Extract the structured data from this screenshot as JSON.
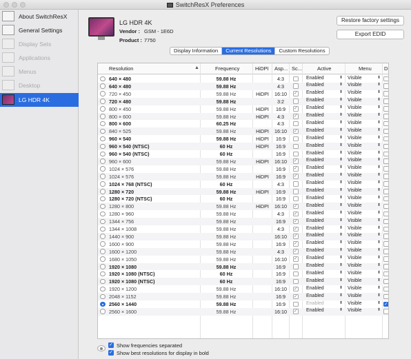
{
  "window": {
    "title": "SwitchResX Preferences"
  },
  "sidebar": {
    "items": [
      {
        "label": "About SwitchResX",
        "icon": "display-icon",
        "state": "normal"
      },
      {
        "label": "General Settings",
        "icon": "switch-icon",
        "state": "normal"
      },
      {
        "label": "Display Sets",
        "icon": "display-sets-icon",
        "state": "disabled"
      },
      {
        "label": "Applications",
        "icon": "applications-icon",
        "state": "disabled"
      },
      {
        "label": "Menus",
        "icon": "menus-icon",
        "state": "disabled"
      },
      {
        "label": "Desktop",
        "icon": "desktop-icon",
        "state": "disabled"
      },
      {
        "label": "LG HDR 4K",
        "icon": "monitor-icon",
        "state": "selected"
      }
    ]
  },
  "device": {
    "name": "LG HDR 4K",
    "vendor_label": "Vendor :",
    "vendor_value": "GSM - 1E6D",
    "product_label": "Product :",
    "product_value": "7750",
    "restore_button": "Restore factory settings",
    "export_button": "Export EDID"
  },
  "tabs": [
    {
      "label": "Display Information",
      "active": false
    },
    {
      "label": "Current Resolutions",
      "active": true
    },
    {
      "label": "Custom Resolutions",
      "active": false
    }
  ],
  "table": {
    "columns": {
      "resolution": "Resolution",
      "frequency": "Frequency",
      "hidpi": "HiDPI",
      "aspect": "Asp...",
      "scaled": "Sc...",
      "active": "Active",
      "menu": "Menu",
      "d": "D"
    },
    "rows": [
      {
        "res": "640 × 480",
        "freq": "59.88 Hz",
        "hidpi": "",
        "aspect": "4:3",
        "scaled": false,
        "active": "Enabled",
        "menu": "Visible",
        "bold": true,
        "selected": false,
        "dim": false
      },
      {
        "res": "640 × 480",
        "freq": "59.88 Hz",
        "hidpi": "",
        "aspect": "4:3",
        "scaled": false,
        "active": "Enabled",
        "menu": "Visible",
        "bold": true,
        "selected": false,
        "dim": false
      },
      {
        "res": "720 × 450",
        "freq": "59.88 Hz",
        "hidpi": "HiDPI",
        "aspect": "16:10",
        "scaled": true,
        "active": "Enabled",
        "menu": "Visible",
        "bold": false,
        "selected": false,
        "dim": false
      },
      {
        "res": "720 × 480",
        "freq": "59.88 Hz",
        "hidpi": "",
        "aspect": "3:2",
        "scaled": false,
        "active": "Enabled",
        "menu": "Visible",
        "bold": true,
        "selected": false,
        "dim": false
      },
      {
        "res": "800 × 450",
        "freq": "59.88 Hz",
        "hidpi": "HiDPI",
        "aspect": "16:9",
        "scaled": true,
        "active": "Enabled",
        "menu": "Visible",
        "bold": false,
        "selected": false,
        "dim": false
      },
      {
        "res": "800 × 600",
        "freq": "59.88 Hz",
        "hidpi": "HiDPI",
        "aspect": "4:3",
        "scaled": true,
        "active": "Enabled",
        "menu": "Visible",
        "bold": false,
        "selected": false,
        "dim": false
      },
      {
        "res": "800 × 600",
        "freq": "60.25 Hz",
        "hidpi": "",
        "aspect": "4:3",
        "scaled": false,
        "active": "Enabled",
        "menu": "Visible",
        "bold": true,
        "selected": false,
        "dim": false
      },
      {
        "res": "840 × 525",
        "freq": "59.88 Hz",
        "hidpi": "HiDPI",
        "aspect": "16:10",
        "scaled": true,
        "active": "Enabled",
        "menu": "Visible",
        "bold": false,
        "selected": false,
        "dim": false
      },
      {
        "res": "960 × 540",
        "freq": "59.88 Hz",
        "hidpi": "HiDPI",
        "aspect": "16:9",
        "scaled": false,
        "active": "Enabled",
        "menu": "Visible",
        "bold": true,
        "selected": false,
        "dim": false
      },
      {
        "res": "960 × 540 (NTSC)",
        "freq": "60 Hz",
        "hidpi": "HiDPI",
        "aspect": "16:9",
        "scaled": false,
        "active": "Enabled",
        "menu": "Visible",
        "bold": true,
        "selected": false,
        "dim": false
      },
      {
        "res": "960 × 540 (NTSC)",
        "freq": "60 Hz",
        "hidpi": "",
        "aspect": "16:9",
        "scaled": false,
        "active": "Enabled",
        "menu": "Visible",
        "bold": true,
        "selected": false,
        "dim": false
      },
      {
        "res": "960 × 600",
        "freq": "59.88 Hz",
        "hidpi": "HiDPI",
        "aspect": "16:10",
        "scaled": true,
        "active": "Enabled",
        "menu": "Visible",
        "bold": false,
        "selected": false,
        "dim": false
      },
      {
        "res": "1024 × 576",
        "freq": "59.88 Hz",
        "hidpi": "",
        "aspect": "16:9",
        "scaled": true,
        "active": "Enabled",
        "menu": "Visible",
        "bold": false,
        "selected": false,
        "dim": false
      },
      {
        "res": "1024 × 576",
        "freq": "59.88 Hz",
        "hidpi": "HiDPI",
        "aspect": "16:9",
        "scaled": true,
        "active": "Enabled",
        "menu": "Visible",
        "bold": false,
        "selected": false,
        "dim": false
      },
      {
        "res": "1024 × 768 (NTSC)",
        "freq": "60 Hz",
        "hidpi": "",
        "aspect": "4:3",
        "scaled": false,
        "active": "Enabled",
        "menu": "Visible",
        "bold": true,
        "selected": false,
        "dim": false
      },
      {
        "res": "1280 × 720",
        "freq": "59.88 Hz",
        "hidpi": "HiDPI",
        "aspect": "16:9",
        "scaled": false,
        "active": "Enabled",
        "menu": "Visible",
        "bold": true,
        "selected": false,
        "dim": false
      },
      {
        "res": "1280 × 720 (NTSC)",
        "freq": "60 Hz",
        "hidpi": "",
        "aspect": "16:9",
        "scaled": false,
        "active": "Enabled",
        "menu": "Visible",
        "bold": true,
        "selected": false,
        "dim": false
      },
      {
        "res": "1280 × 800",
        "freq": "59.88 Hz",
        "hidpi": "HiDPI",
        "aspect": "16:10",
        "scaled": true,
        "active": "Enabled",
        "menu": "Visible",
        "bold": false,
        "selected": false,
        "dim": false
      },
      {
        "res": "1280 × 960",
        "freq": "59.88 Hz",
        "hidpi": "",
        "aspect": "4:3",
        "scaled": true,
        "active": "Enabled",
        "menu": "Visible",
        "bold": false,
        "selected": false,
        "dim": false
      },
      {
        "res": "1344 × 756",
        "freq": "59.88 Hz",
        "hidpi": "",
        "aspect": "16:9",
        "scaled": true,
        "active": "Enabled",
        "menu": "Visible",
        "bold": false,
        "selected": false,
        "dim": false
      },
      {
        "res": "1344 × 1008",
        "freq": "59.88 Hz",
        "hidpi": "",
        "aspect": "4:3",
        "scaled": true,
        "active": "Enabled",
        "menu": "Visible",
        "bold": false,
        "selected": false,
        "dim": false
      },
      {
        "res": "1440 × 900",
        "freq": "59.88 Hz",
        "hidpi": "",
        "aspect": "16:10",
        "scaled": true,
        "active": "Enabled",
        "menu": "Visible",
        "bold": false,
        "selected": false,
        "dim": false
      },
      {
        "res": "1600 × 900",
        "freq": "59.88 Hz",
        "hidpi": "",
        "aspect": "16:9",
        "scaled": true,
        "active": "Enabled",
        "menu": "Visible",
        "bold": false,
        "selected": false,
        "dim": false
      },
      {
        "res": "1600 × 1200",
        "freq": "59.88 Hz",
        "hidpi": "",
        "aspect": "4:3",
        "scaled": true,
        "active": "Enabled",
        "menu": "Visible",
        "bold": false,
        "selected": false,
        "dim": false
      },
      {
        "res": "1680 × 1050",
        "freq": "59.88 Hz",
        "hidpi": "",
        "aspect": "16:10",
        "scaled": true,
        "active": "Enabled",
        "menu": "Visible",
        "bold": false,
        "selected": false,
        "dim": false
      },
      {
        "res": "1920 × 1080",
        "freq": "59.88 Hz",
        "hidpi": "",
        "aspect": "16:9",
        "scaled": false,
        "active": "Enabled",
        "menu": "Visible",
        "bold": true,
        "selected": false,
        "dim": false
      },
      {
        "res": "1920 × 1080 (NTSC)",
        "freq": "60 Hz",
        "hidpi": "",
        "aspect": "16:9",
        "scaled": false,
        "active": "Enabled",
        "menu": "Visible",
        "bold": true,
        "selected": false,
        "dim": false
      },
      {
        "res": "1920 × 1080 (NTSC)",
        "freq": "60 Hz",
        "hidpi": "",
        "aspect": "16:9",
        "scaled": false,
        "active": "Enabled",
        "menu": "Visible",
        "bold": true,
        "selected": false,
        "dim": false
      },
      {
        "res": "1920 × 1200",
        "freq": "59.88 Hz",
        "hidpi": "",
        "aspect": "16:10",
        "scaled": true,
        "active": "Enabled",
        "menu": "Visible",
        "bold": false,
        "selected": false,
        "dim": false
      },
      {
        "res": "2048 × 1152",
        "freq": "59.88 Hz",
        "hidpi": "",
        "aspect": "16:9",
        "scaled": true,
        "active": "Enabled",
        "menu": "Visible",
        "bold": false,
        "selected": false,
        "dim": false
      },
      {
        "res": "2560 × 1440",
        "freq": "59.88 Hz",
        "hidpi": "",
        "aspect": "16:9",
        "scaled": false,
        "active": "Enabled",
        "menu": "Visible",
        "bold": true,
        "selected": true,
        "dim": true
      },
      {
        "res": "2560 × 1600",
        "freq": "59.88 Hz",
        "hidpi": "",
        "aspect": "16:10",
        "scaled": true,
        "active": "Enabled",
        "menu": "Visible",
        "bold": false,
        "selected": false,
        "dim": false
      }
    ]
  },
  "footer": {
    "show_freq_label": "Show frequencies separated",
    "show_best_label": "Show best resolutions for display in bold"
  },
  "colors": {
    "accent": "#2a6de0"
  }
}
